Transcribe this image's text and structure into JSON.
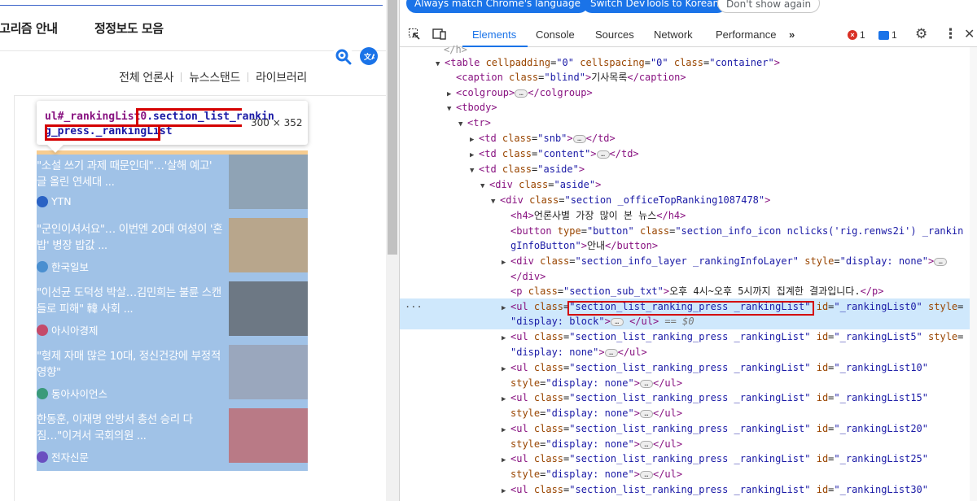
{
  "page": {
    "nav": {
      "algorithm": "알고리즘 안내",
      "correction": "정정보도 모음"
    },
    "press_links": [
      "전체 언론사",
      "뉴스스탠드",
      "라이브러리"
    ],
    "tooltip": {
      "selector_id": "ul#_rankingList0",
      "selector_class_1": ".section_list_rankin",
      "selector_class_2": "g_press._rankingList",
      "dims": "300 × 352"
    },
    "articles": [
      {
        "title": "\"소설 쓰기 과제 때문인데\"…'살해 예고' 글 올린 연세대 ...",
        "press": "YTN",
        "logo_color": "#2a62c4",
        "thumb_color": "#8fa3b5"
      },
      {
        "title": "\"군인이셔서요\"… 이번엔 20대 여성이 '혼밥' 병장 밥값 ...",
        "press": "한국일보",
        "logo_color": "#4a8fd0",
        "thumb_color": "#b8a68c"
      },
      {
        "title": "\"이선균 도덕성 박살…김민희는 불륜 스캔들로 피해\" 韓 사회 ...",
        "press": "아시아경제",
        "logo_color": "#c44a6a",
        "thumb_color": "#6d7884"
      },
      {
        "title": "\"형제 자매 많은 10대, 정신건강에 부정적 영향\"",
        "press": "동아사이언스",
        "logo_color": "#3a9a7a",
        "thumb_color": "#9aa7bd"
      },
      {
        "title": "한동훈, 이재명 안방서 총선 승리 다짐…\"이겨서 국회의원 ...",
        "press": "전자신문",
        "logo_color": "#6a4fc0",
        "thumb_color": "#b97a86"
      }
    ]
  },
  "devtools": {
    "banner": {
      "match": "Always match Chrome's language",
      "switch": "Switch DevTools to Korean",
      "dismiss": "Don't show again"
    },
    "tabs": [
      "Elements",
      "Console",
      "Sources",
      "Network",
      "Performance"
    ],
    "more_tabs": "»",
    "error_count": "1",
    "message_count": "1",
    "tree": {
      "l0": {
        "tag_open": "<table ",
        "a1": "cellpadding",
        "v1": "\"0\"",
        "a2": "cellspacing",
        "v2": "\"0\"",
        "a3": "class",
        "v3": "\"container\"",
        "close": ">"
      },
      "l1": {
        "open": "<caption ",
        "a1": "class",
        "v1": "\"blind\"",
        "gt": ">",
        "text": "기사목록",
        "close": "</caption>"
      },
      "l2": {
        "open": "<colgroup>",
        "close": "</colgroup>"
      },
      "l3": {
        "open": "<tbody>"
      },
      "l4": {
        "open": "<tr>"
      },
      "l5": {
        "open": "<td ",
        "a1": "class",
        "v1": "\"snb\"",
        "gt": ">",
        "close": "</td>"
      },
      "l6": {
        "open": "<td ",
        "a1": "class",
        "v1": "\"content\"",
        "gt": ">",
        "close": "</td>"
      },
      "l7": {
        "open": "<td ",
        "a1": "class",
        "v1": "\"aside\"",
        "gt": ">"
      },
      "l8": {
        "open": "<div ",
        "a1": "class",
        "v1": "\"aside\"",
        "gt": ">"
      },
      "l9": {
        "open": "<div ",
        "a1": "class",
        "v1": "\"section _officeTopRanking1087478\"",
        "gt": ">"
      },
      "l10": {
        "open": "<h4>",
        "text": "언론사별 가장 많이 본 뉴스",
        "close": "</h4>"
      },
      "l11": {
        "open": "<button ",
        "a1": "type",
        "v1": "\"button\"",
        "a2": "class",
        "v2": "\"section_info_icon nclicks('rig.renws2i') _rankin"
      },
      "l12": {
        "v": "gInfoButton\"",
        "gt": ">",
        "text": "안내",
        "close": "</button>"
      },
      "l13": {
        "open": "<div ",
        "a1": "class",
        "v1": "\"section_info_layer _rankingInfoLayer\"",
        "a2": "style",
        "v2": "\"display: none\"",
        "gt": ">"
      },
      "l14": {
        "close": "</div>"
      },
      "l15": {
        "open": "<p ",
        "a1": "class",
        "v1": "\"section_sub_txt\"",
        "gt": ">",
        "text": "오후 4시~오후 5시까지 집계한 결과입니다.",
        "close": "</p>"
      },
      "l16": {
        "open": "<ul ",
        "a1": "class",
        "v1": "\"section_list_ranking_press _rankingList\"",
        "a2": "id",
        "v2": "\"_rankingList0\"",
        "a3": "style"
      },
      "l17": {
        "v": "\"display: block\"",
        "gt": ">",
        "close": "</ul>",
        "eq": "== $0"
      },
      "l18": {
        "open": "<ul ",
        "a1": "class",
        "v1": "\"section_list_ranking_press _rankingList\"",
        "a2": "id",
        "v2": "\"_rankingList5\"",
        "a3": "style"
      },
      "l19": {
        "v": "\"display: none\"",
        "gt": ">",
        "close": "</ul>"
      },
      "l20": {
        "open": "<ul ",
        "a1": "class",
        "v1": "\"section_list_ranking_press _rankingList\"",
        "a2": "id",
        "v2": "\"_rankingList10\""
      },
      "l21": {
        "a": "style",
        "v": "\"display: none\"",
        "gt": ">",
        "close": "</ul>"
      },
      "l22": {
        "open": "<ul ",
        "a1": "class",
        "v1": "\"section_list_ranking_press _rankingList\"",
        "a2": "id",
        "v2": "\"_rankingList15\""
      },
      "l23": {
        "a": "style",
        "v": "\"display: none\"",
        "gt": ">",
        "close": "</ul>"
      },
      "l24": {
        "open": "<ul ",
        "a1": "class",
        "v1": "\"section_list_ranking_press _rankingList\"",
        "a2": "id",
        "v2": "\"_rankingList20\""
      },
      "l25": {
        "a": "style",
        "v": "\"display: none\"",
        "gt": ">",
        "close": "</ul>"
      },
      "l26": {
        "open": "<ul ",
        "a1": "class",
        "v1": "\"section_list_ranking_press _rankingList\"",
        "a2": "id",
        "v2": "\"_rankingList25\""
      },
      "l27": {
        "a": "style",
        "v": "\"display: none\"",
        "gt": ">",
        "close": "</ul>"
      },
      "l28": {
        "open": "<ul ",
        "a1": "class",
        "v1": "\"section_list_ranking_press _rankingList\"",
        "a2": "id",
        "v2": "\"_rankingList30\""
      }
    },
    "selected_dots": "..."
  },
  "colors": {
    "highlight_blue": "#a0c2e7",
    "padding_orange": "#f6cc90",
    "annotation_red": "#d40000",
    "accent": "#1a73e8"
  }
}
